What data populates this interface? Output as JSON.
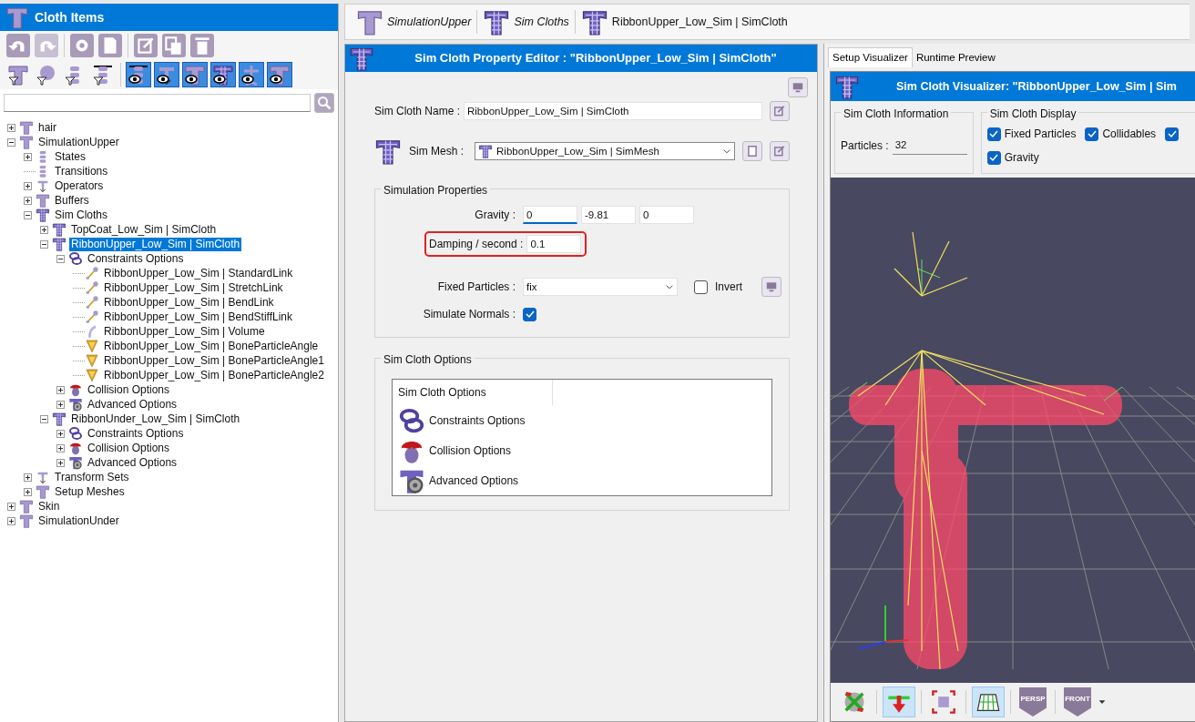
{
  "cloth_items": {
    "title": "Cloth Items",
    "edit_toolbar": [
      {
        "disabled": false
      },
      {
        "disabled": true
      },
      {
        "disabled": false
      },
      {
        "disabled": false
      },
      {
        "disabled": false
      },
      {
        "disabled": false
      },
      {
        "disabled": false
      }
    ],
    "filter_toolbar": [
      {
        "on": false
      },
      {
        "on": false
      },
      {
        "on": false
      },
      {
        "on": false
      },
      {
        "on": true
      },
      {
        "on": true
      },
      {
        "on": true
      },
      {
        "on": true
      },
      {
        "on": true
      },
      {
        "on": true
      }
    ],
    "tree": [
      {
        "label": "hair",
        "kind": "cloth",
        "expanded": false,
        "selected": false
      },
      {
        "label": "SimulationUpper",
        "kind": "cloth",
        "expanded": true,
        "selected": false,
        "children": [
          {
            "label": "States",
            "kind": "states",
            "expanded": false,
            "selected": false
          },
          {
            "label": "Transitions",
            "kind": "states",
            "selected": false
          },
          {
            "label": "Operators",
            "kind": "operators",
            "expanded": false,
            "selected": false
          },
          {
            "label": "Buffers",
            "kind": "cloth",
            "expanded": false,
            "selected": false
          },
          {
            "label": "Sim Cloths",
            "kind": "mesh",
            "expanded": true,
            "selected": false,
            "children": [
              {
                "label": "TopCoat_Low_Sim | SimCloth",
                "kind": "mesh",
                "expanded": false,
                "selected": false
              },
              {
                "label": "RibbonUpper_Low_Sim | SimCloth",
                "kind": "mesh",
                "expanded": true,
                "selected": true,
                "children": [
                  {
                    "label": "Constraints Options",
                    "kind": "chain",
                    "expanded": true,
                    "selected": false,
                    "children": [
                      {
                        "label": "RibbonUpper_Low_Sim | StandardLink",
                        "kind": "link",
                        "selected": false
                      },
                      {
                        "label": "RibbonUpper_Low_Sim | StretchLink",
                        "kind": "link",
                        "selected": false
                      },
                      {
                        "label": "RibbonUpper_Low_Sim | BendLink",
                        "kind": "link",
                        "selected": false
                      },
                      {
                        "label": "RibbonUpper_Low_Sim | BendStiffLink",
                        "kind": "link",
                        "selected": false
                      },
                      {
                        "label": "RibbonUpper_Low_Sim | Volume",
                        "kind": "volume",
                        "selected": false
                      },
                      {
                        "label": "RibbonUpper_Low_Sim | BoneParticleAngle",
                        "kind": "angle",
                        "selected": false
                      },
                      {
                        "label": "RibbonUpper_Low_Sim | BoneParticleAngle1",
                        "kind": "angle",
                        "selected": false
                      },
                      {
                        "label": "RibbonUpper_Low_Sim | BoneParticleAngle2",
                        "kind": "angle",
                        "selected": false
                      }
                    ]
                  },
                  {
                    "label": "Collision Options",
                    "kind": "collision",
                    "expanded": false,
                    "selected": false
                  },
                  {
                    "label": "Advanced Options",
                    "kind": "advanced",
                    "expanded": false,
                    "selected": false
                  }
                ]
              },
              {
                "label": "RibbonUnder_Low_Sim | SimCloth",
                "kind": "mesh",
                "expanded": true,
                "selected": false,
                "children": [
                  {
                    "label": "Constraints Options",
                    "kind": "chain",
                    "expanded": false,
                    "selected": false
                  },
                  {
                    "label": "Collision Options",
                    "kind": "collision",
                    "expanded": false,
                    "selected": false
                  },
                  {
                    "label": "Advanced Options",
                    "kind": "advanced",
                    "expanded": false,
                    "selected": false
                  }
                ]
              }
            ]
          },
          {
            "label": "Transform Sets",
            "kind": "operators",
            "expanded": false,
            "selected": false
          },
          {
            "label": "Setup Meshes",
            "kind": "cloth",
            "expanded": false,
            "selected": false
          }
        ]
      },
      {
        "label": "Skin",
        "kind": "cloth",
        "expanded": false,
        "selected": false
      },
      {
        "label": "SimulationUnder",
        "kind": "cloth",
        "expanded": false,
        "selected": false
      }
    ]
  },
  "breadcrumb": [
    {
      "label": "SimulationUpper",
      "kind": "cloth",
      "current": false
    },
    {
      "label": "Sim Cloths",
      "kind": "mesh",
      "current": false
    },
    {
      "label": "RibbonUpper_Low_Sim | SimCloth",
      "kind": "mesh",
      "current": true
    }
  ],
  "property_editor": {
    "title": "Sim Cloth Property Editor : \"RibbonUpper_Low_Sim | SimCloth\"",
    "name_label": "Sim Cloth Name :",
    "name_value": "RibbonUpper_Low_Sim | SimCloth",
    "mesh_label": "Sim Mesh :",
    "mesh_value": "RibbonUpper_Low_Sim | SimMesh",
    "simulation_properties": {
      "title": "Simulation Properties",
      "gravity_label": "Gravity :",
      "gravity": [
        "0",
        "-9.81",
        "0"
      ],
      "damping_label": "Damping / second :",
      "damping_value": "0.1",
      "damping_highlighted": true,
      "fixed_label": "Fixed Particles :",
      "fixed_value": "fix",
      "invert_label": "Invert",
      "invert_checked": false,
      "normals_label": "Simulate Normals :",
      "normals_checked": true
    },
    "options": {
      "title": "Sim Cloth Options",
      "header": "Sim Cloth Options",
      "items": [
        {
          "label": "Constraints Options",
          "kind": "chain"
        },
        {
          "label": "Collision Options",
          "kind": "collision"
        },
        {
          "label": "Advanced Options",
          "kind": "advanced"
        }
      ]
    }
  },
  "visualizer": {
    "tabs": [
      {
        "label": "Setup Visualizer",
        "selected": true
      },
      {
        "label": "Runtime Preview",
        "selected": false
      }
    ],
    "title": "Sim Cloth Visualizer: \"RibbonUpper_Low_Sim | Sim",
    "info": {
      "title": "Sim Cloth Information",
      "particles_label": "Particles :",
      "particles_value": "32"
    },
    "display": {
      "title": "Sim Cloth Display",
      "options": [
        {
          "label": "Fixed Particles",
          "checked": true
        },
        {
          "label": "Collidables",
          "checked": true
        },
        {
          "checked": true
        },
        {
          "label": "Gravity",
          "checked": true
        }
      ]
    },
    "toolbar": [
      {
        "kind": "gizmo",
        "on": false
      },
      {
        "kind": "arrows",
        "on": true
      },
      {
        "kind": "frame",
        "on": false
      },
      {
        "kind": "grid",
        "on": true
      },
      {
        "kind": "view",
        "label": "PERSP",
        "on": false
      },
      {
        "kind": "view",
        "label": "FRONT",
        "on": false
      }
    ]
  }
}
